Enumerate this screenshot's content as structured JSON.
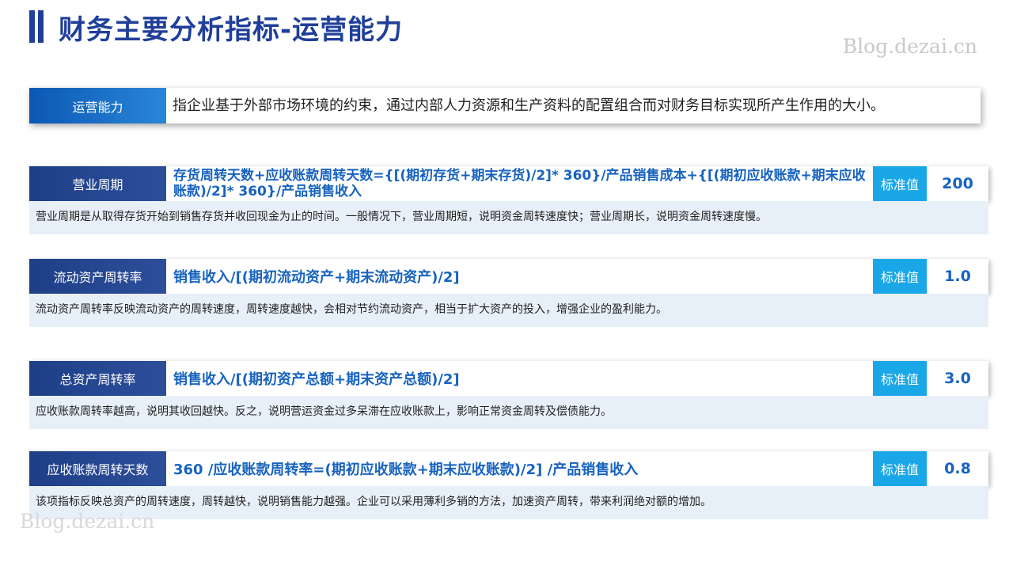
{
  "page": {
    "title": "财务主要分析指标-运营能力",
    "watermark": "Blog.dezai.cn"
  },
  "definition": {
    "label": "运营能力",
    "text": "指企业基于外部市场环境的约束，通过内部人力资源和生产资料的配置组合而对财务目标实现所产生作用的大小。"
  },
  "metrics": [
    {
      "label": "营业周期",
      "formula": "存货周转天数+应收账款周转天数={[(期初存货+期末存货)/2]* 360}/产品销售成本+{[(期初应收账款+期末应收账款)/2]* 360}/产品销售收入",
      "std_label": "标准值",
      "std_value": "200",
      "description": "营业周期是从取得存货开始到销售存货并收回现金为止的时间。一般情况下，营业周期短，说明资金周转速度快；营业周期长，说明资金周转速度慢。"
    },
    {
      "label": "流动资产周转率",
      "formula": "销售收入/[(期初流动资产+期末流动资产)/2]",
      "std_label": "标准值",
      "std_value": "1.0",
      "description": "流动资产周转率反映流动资产的周转速度，周转速度越快，会相对节约流动资产，相当于扩大资产的投入，增强企业的盈利能力。"
    },
    {
      "label": "总资产周转率",
      "formula": "销售收入/[(期初资产总额+期末资产总额)/2]",
      "std_label": "标准值",
      "std_value": "3.0",
      "description": "应收账款周转率越高，说明其收回越快。反之，说明营运资金过多呆滞在应收账款上，影响正常资金周转及偿债能力。"
    },
    {
      "label": "应收账款周转天数",
      "formula": "360 /应收账款周转率=(期初应收账款+期末应收账款)/2] /产品销售收入",
      "std_label": "标准值",
      "std_value": "0.8",
      "description": "该项指标反映总资产的周转速度，周转越快，说明销售能力越强。企业可以采用薄利多销的方法，加速资产周转，带来利润绝对额的增加。"
    }
  ]
}
